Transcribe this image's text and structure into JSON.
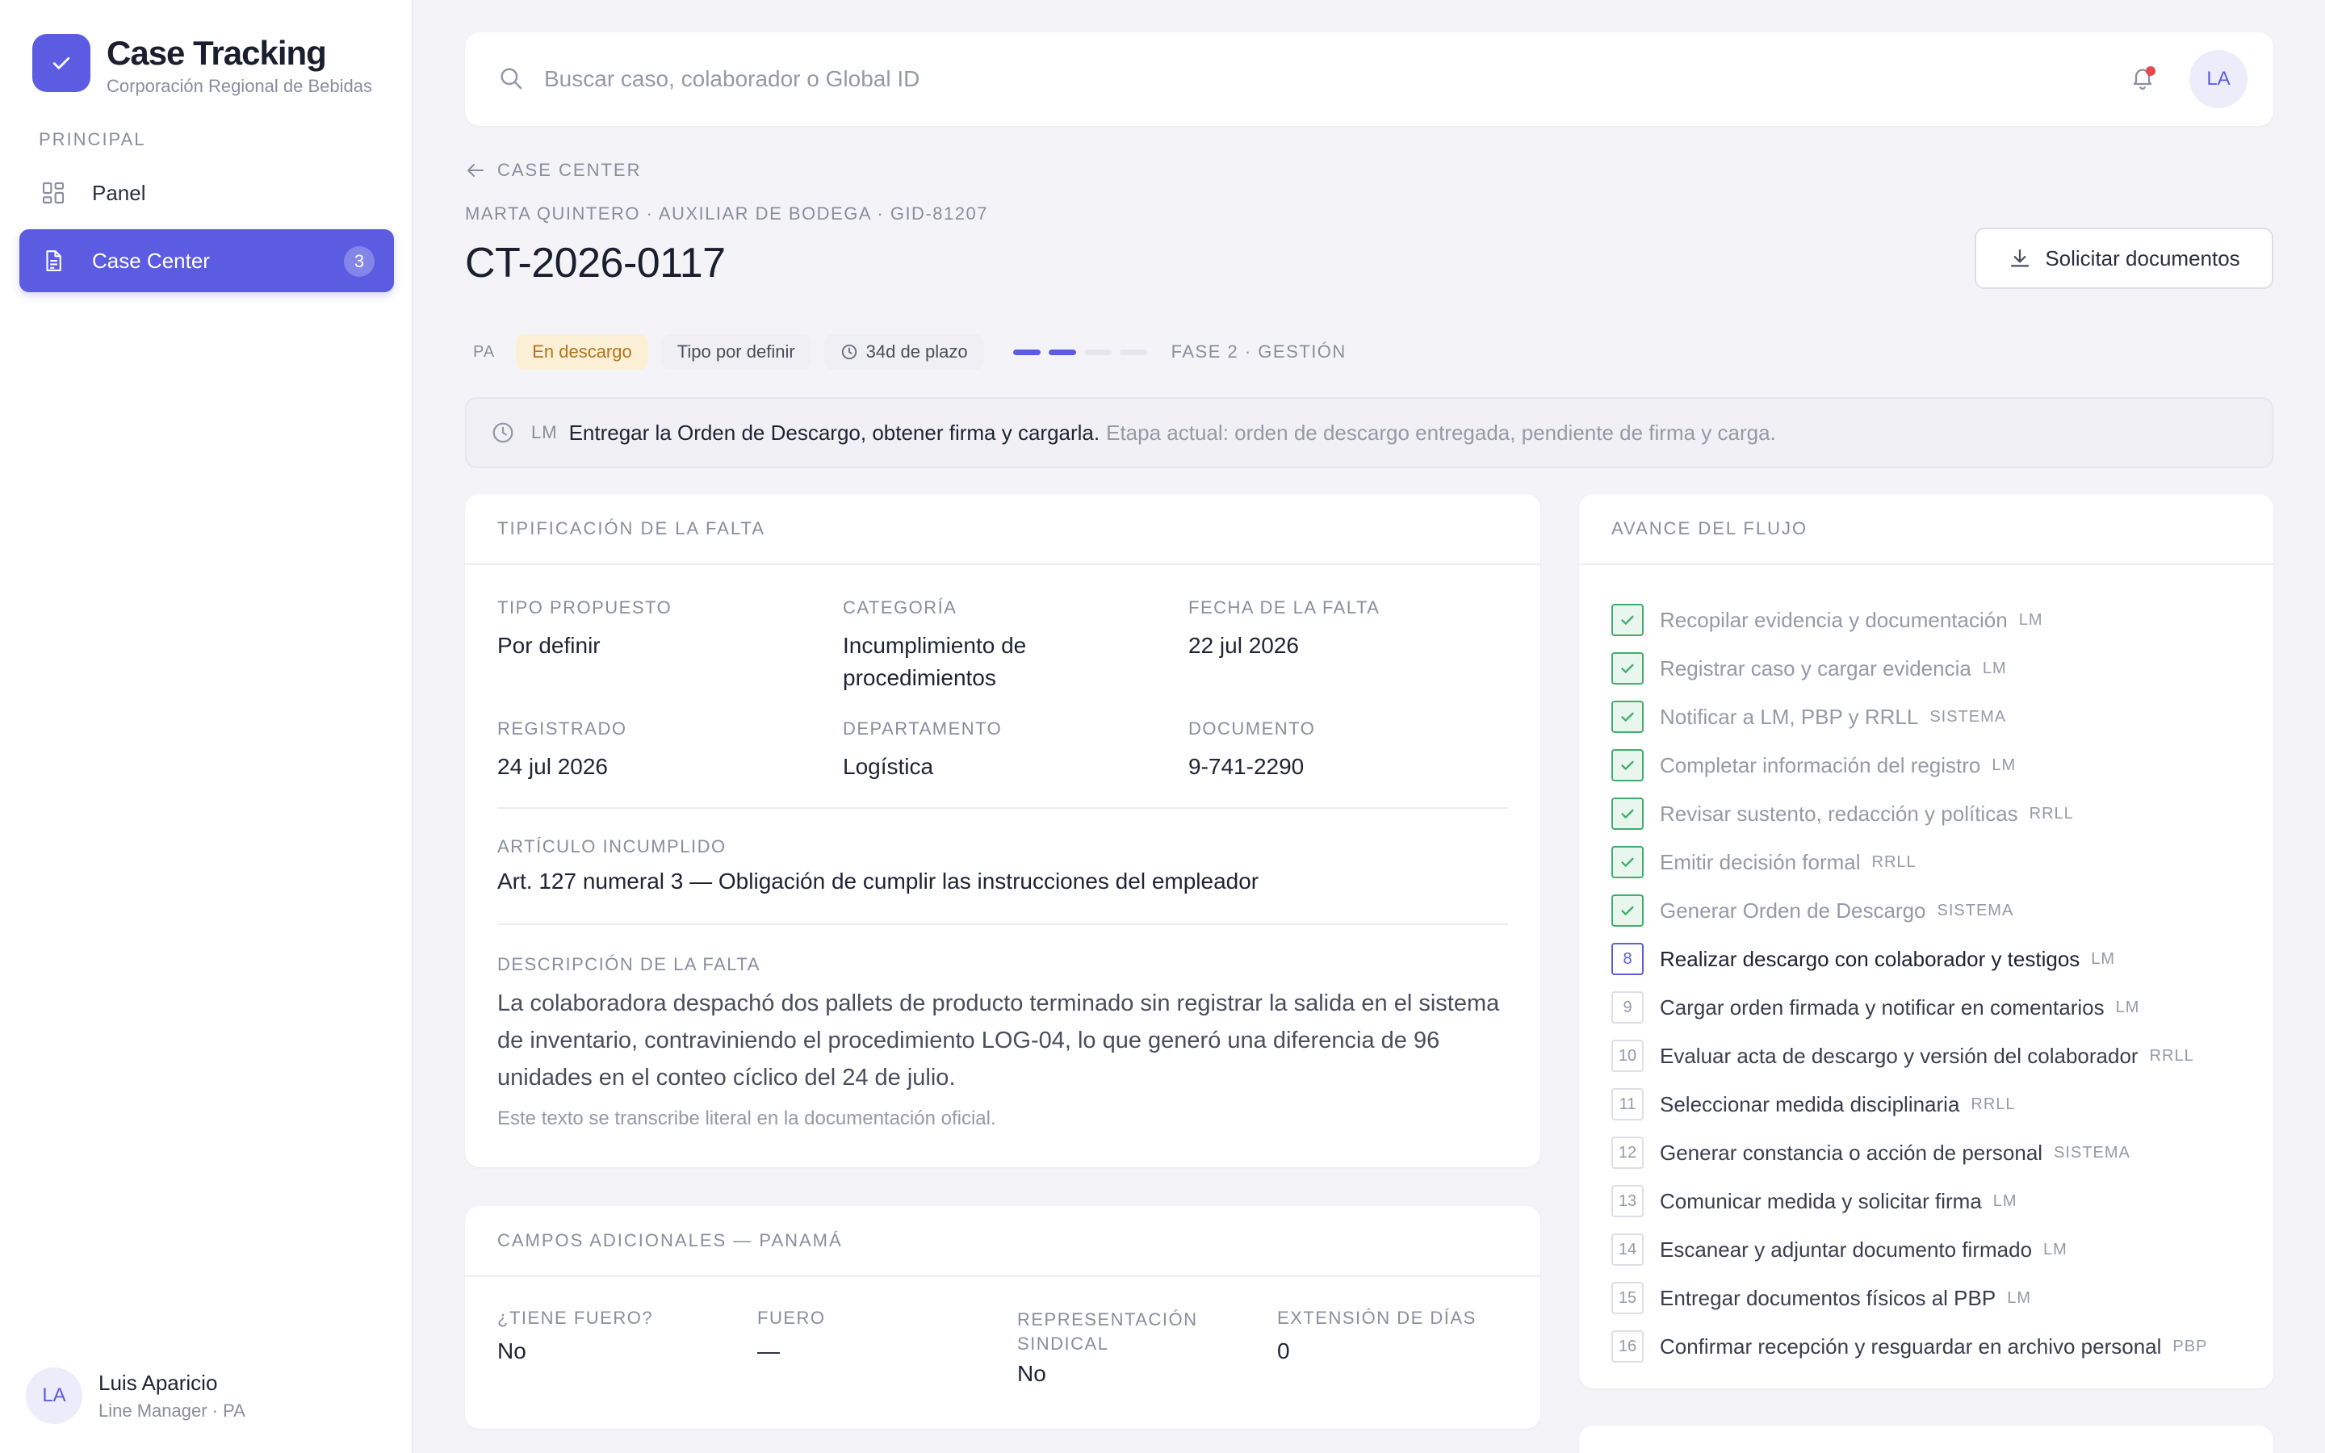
{
  "brand": {
    "title": "Case Tracking",
    "subtitle": "Corporación Regional de Bebidas"
  },
  "sidebar": {
    "section_label": "PRINCIPAL",
    "items": [
      {
        "label": "Panel",
        "icon": "grid-icon"
      },
      {
        "label": "Case Center",
        "icon": "document-icon",
        "badge": "3",
        "active": true
      }
    ]
  },
  "user": {
    "initials": "LA",
    "name": "Luis Aparicio",
    "role": "Line Manager · PA"
  },
  "topbar": {
    "search_placeholder": "Buscar caso, colaborador o Global ID",
    "avatar_initials": "LA"
  },
  "header": {
    "back_label": "CASE CENTER",
    "meta": "MARTA QUINTERO · AUXILIAR DE BODEGA · GID-81207",
    "case_id": "CT-2026-0117",
    "request_button": "Solicitar documentos"
  },
  "chips": {
    "country": "PA",
    "status": "En descargo",
    "type": "Tipo por definir",
    "deadline": "34d de plazo",
    "progress": {
      "completed": 2,
      "total": 4
    },
    "phase": "FASE 2 · GESTIÓN"
  },
  "banner": {
    "role": "LM",
    "main": "Entregar la Orden de Descargo, obtener firma y cargarla.",
    "sub": "Etapa actual: orden de descargo entregada, pendiente de firma y carga."
  },
  "tipificacion": {
    "title": "TIPIFICACIÓN DE LA FALTA",
    "fields": [
      {
        "label": "TIPO PROPUESTO",
        "value": "Por definir"
      },
      {
        "label": "CATEGORÍA",
        "value": "Incumplimiento de procedimientos"
      },
      {
        "label": "FECHA DE LA FALTA",
        "value": "22 jul 2026"
      },
      {
        "label": "REGISTRADO",
        "value": "24 jul 2026"
      },
      {
        "label": "DEPARTAMENTO",
        "value": "Logística"
      },
      {
        "label": "DOCUMENTO",
        "value": "9-741-2290"
      }
    ],
    "articulo_label": "ARTÍCULO INCUMPLIDO",
    "articulo_value": "Art. 127 numeral 3 — Obligación de cumplir las instrucciones del empleador",
    "descripcion_label": "DESCRIPCIÓN DE LA FALTA",
    "descripcion_value": "La colaboradora despachó dos pallets de producto terminado sin registrar la salida en el sistema de inventario, contraviniendo el procedimiento LOG-04, lo que generó una diferencia de 96 unidades en el conteo cíclico del 24 de julio.",
    "descripcion_note": "Este texto se transcribe literal en la documentación oficial."
  },
  "campos": {
    "title": "CAMPOS ADICIONALES — PANAMÁ",
    "fields": [
      {
        "label": "¿TIENE FUERO?",
        "value": "No"
      },
      {
        "label": "FUERO",
        "value": "—"
      },
      {
        "label": "REPRESENTACIÓN SINDICAL",
        "value": "No"
      },
      {
        "label": "EXTENSIÓN DE DÍAS",
        "value": "0"
      }
    ]
  },
  "flujo": {
    "title": "AVANCE DEL FLUJO",
    "steps": [
      {
        "num": "1",
        "label": "Recopilar evidencia y documentación",
        "role": "LM",
        "state": "done"
      },
      {
        "num": "2",
        "label": "Registrar caso y cargar evidencia",
        "role": "LM",
        "state": "done"
      },
      {
        "num": "3",
        "label": "Notificar a LM, PBP y RRLL",
        "role": "SISTEMA",
        "state": "done"
      },
      {
        "num": "4",
        "label": "Completar información del registro",
        "role": "LM",
        "state": "done"
      },
      {
        "num": "5",
        "label": "Revisar sustento, redacción y políticas",
        "role": "RRLL",
        "state": "done"
      },
      {
        "num": "6",
        "label": "Emitir decisión formal",
        "role": "RRLL",
        "state": "done"
      },
      {
        "num": "7",
        "label": "Generar Orden de Descargo",
        "role": "SISTEMA",
        "state": "done"
      },
      {
        "num": "8",
        "label": "Realizar descargo con colaborador y testigos",
        "role": "LM",
        "state": "current"
      },
      {
        "num": "9",
        "label": "Cargar orden firmada y notificar en comentarios",
        "role": "LM",
        "state": "pending"
      },
      {
        "num": "10",
        "label": "Evaluar acta de descargo y versión del colaborador",
        "role": "RRLL",
        "state": "pending"
      },
      {
        "num": "11",
        "label": "Seleccionar medida disciplinaria",
        "role": "RRLL",
        "state": "pending"
      },
      {
        "num": "12",
        "label": "Generar constancia o acción de personal",
        "role": "SISTEMA",
        "state": "pending"
      },
      {
        "num": "13",
        "label": "Comunicar medida y solicitar firma",
        "role": "LM",
        "state": "pending"
      },
      {
        "num": "14",
        "label": "Escanear y adjuntar documento firmado",
        "role": "LM",
        "state": "pending"
      },
      {
        "num": "15",
        "label": "Entregar documentos físicos al PBP",
        "role": "LM",
        "state": "pending"
      },
      {
        "num": "16",
        "label": "Confirmar recepción y resguardar en archivo personal",
        "role": "PBP",
        "state": "pending"
      }
    ]
  },
  "colors": {
    "accent": "#5b5ce2",
    "done": "#3fae6d",
    "status_bg": "#fbefd6",
    "status_fg": "#b4741a",
    "notification": "#e5484d"
  }
}
